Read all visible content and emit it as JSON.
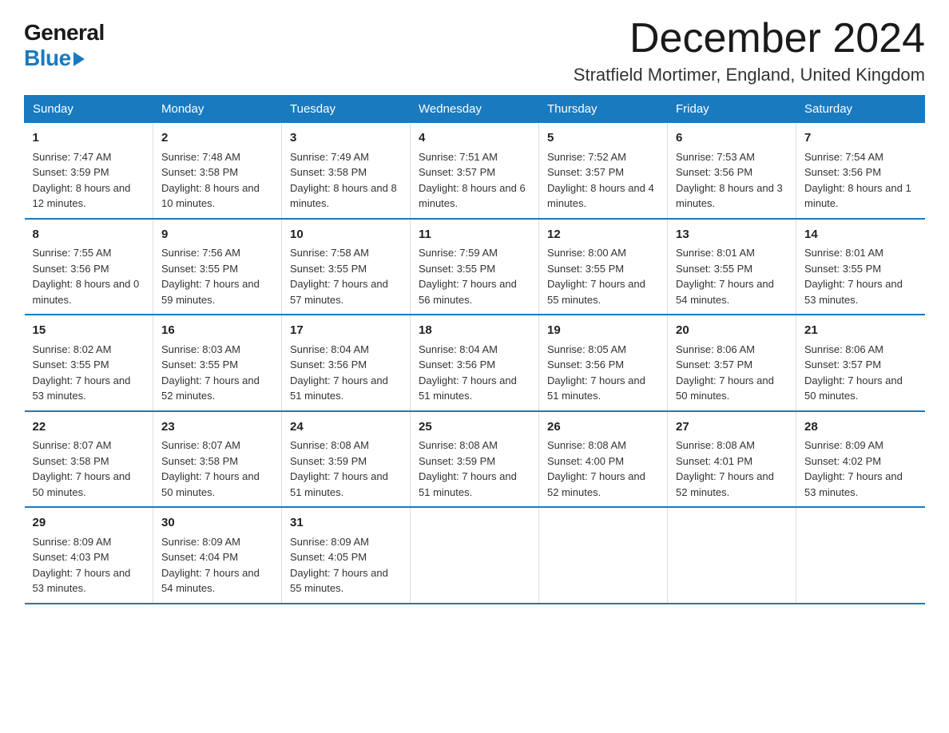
{
  "logo": {
    "general": "General",
    "blue": "Blue"
  },
  "header": {
    "month": "December 2024",
    "location": "Stratfield Mortimer, England, United Kingdom"
  },
  "days_of_week": [
    "Sunday",
    "Monday",
    "Tuesday",
    "Wednesday",
    "Thursday",
    "Friday",
    "Saturday"
  ],
  "weeks": [
    [
      {
        "day": "1",
        "sunrise": "7:47 AM",
        "sunset": "3:59 PM",
        "daylight": "8 hours and 12 minutes."
      },
      {
        "day": "2",
        "sunrise": "7:48 AM",
        "sunset": "3:58 PM",
        "daylight": "8 hours and 10 minutes."
      },
      {
        "day": "3",
        "sunrise": "7:49 AM",
        "sunset": "3:58 PM",
        "daylight": "8 hours and 8 minutes."
      },
      {
        "day": "4",
        "sunrise": "7:51 AM",
        "sunset": "3:57 PM",
        "daylight": "8 hours and 6 minutes."
      },
      {
        "day": "5",
        "sunrise": "7:52 AM",
        "sunset": "3:57 PM",
        "daylight": "8 hours and 4 minutes."
      },
      {
        "day": "6",
        "sunrise": "7:53 AM",
        "sunset": "3:56 PM",
        "daylight": "8 hours and 3 minutes."
      },
      {
        "day": "7",
        "sunrise": "7:54 AM",
        "sunset": "3:56 PM",
        "daylight": "8 hours and 1 minute."
      }
    ],
    [
      {
        "day": "8",
        "sunrise": "7:55 AM",
        "sunset": "3:56 PM",
        "daylight": "8 hours and 0 minutes."
      },
      {
        "day": "9",
        "sunrise": "7:56 AM",
        "sunset": "3:55 PM",
        "daylight": "7 hours and 59 minutes."
      },
      {
        "day": "10",
        "sunrise": "7:58 AM",
        "sunset": "3:55 PM",
        "daylight": "7 hours and 57 minutes."
      },
      {
        "day": "11",
        "sunrise": "7:59 AM",
        "sunset": "3:55 PM",
        "daylight": "7 hours and 56 minutes."
      },
      {
        "day": "12",
        "sunrise": "8:00 AM",
        "sunset": "3:55 PM",
        "daylight": "7 hours and 55 minutes."
      },
      {
        "day": "13",
        "sunrise": "8:01 AM",
        "sunset": "3:55 PM",
        "daylight": "7 hours and 54 minutes."
      },
      {
        "day": "14",
        "sunrise": "8:01 AM",
        "sunset": "3:55 PM",
        "daylight": "7 hours and 53 minutes."
      }
    ],
    [
      {
        "day": "15",
        "sunrise": "8:02 AM",
        "sunset": "3:55 PM",
        "daylight": "7 hours and 53 minutes."
      },
      {
        "day": "16",
        "sunrise": "8:03 AM",
        "sunset": "3:55 PM",
        "daylight": "7 hours and 52 minutes."
      },
      {
        "day": "17",
        "sunrise": "8:04 AM",
        "sunset": "3:56 PM",
        "daylight": "7 hours and 51 minutes."
      },
      {
        "day": "18",
        "sunrise": "8:04 AM",
        "sunset": "3:56 PM",
        "daylight": "7 hours and 51 minutes."
      },
      {
        "day": "19",
        "sunrise": "8:05 AM",
        "sunset": "3:56 PM",
        "daylight": "7 hours and 51 minutes."
      },
      {
        "day": "20",
        "sunrise": "8:06 AM",
        "sunset": "3:57 PM",
        "daylight": "7 hours and 50 minutes."
      },
      {
        "day": "21",
        "sunrise": "8:06 AM",
        "sunset": "3:57 PM",
        "daylight": "7 hours and 50 minutes."
      }
    ],
    [
      {
        "day": "22",
        "sunrise": "8:07 AM",
        "sunset": "3:58 PM",
        "daylight": "7 hours and 50 minutes."
      },
      {
        "day": "23",
        "sunrise": "8:07 AM",
        "sunset": "3:58 PM",
        "daylight": "7 hours and 50 minutes."
      },
      {
        "day": "24",
        "sunrise": "8:08 AM",
        "sunset": "3:59 PM",
        "daylight": "7 hours and 51 minutes."
      },
      {
        "day": "25",
        "sunrise": "8:08 AM",
        "sunset": "3:59 PM",
        "daylight": "7 hours and 51 minutes."
      },
      {
        "day": "26",
        "sunrise": "8:08 AM",
        "sunset": "4:00 PM",
        "daylight": "7 hours and 52 minutes."
      },
      {
        "day": "27",
        "sunrise": "8:08 AM",
        "sunset": "4:01 PM",
        "daylight": "7 hours and 52 minutes."
      },
      {
        "day": "28",
        "sunrise": "8:09 AM",
        "sunset": "4:02 PM",
        "daylight": "7 hours and 53 minutes."
      }
    ],
    [
      {
        "day": "29",
        "sunrise": "8:09 AM",
        "sunset": "4:03 PM",
        "daylight": "7 hours and 53 minutes."
      },
      {
        "day": "30",
        "sunrise": "8:09 AM",
        "sunset": "4:04 PM",
        "daylight": "7 hours and 54 minutes."
      },
      {
        "day": "31",
        "sunrise": "8:09 AM",
        "sunset": "4:05 PM",
        "daylight": "7 hours and 55 minutes."
      },
      null,
      null,
      null,
      null
    ]
  ]
}
